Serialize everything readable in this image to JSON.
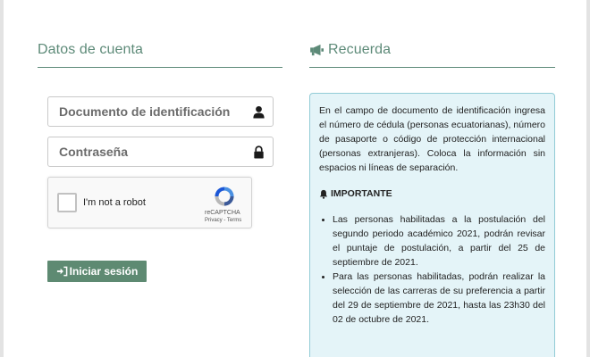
{
  "account_section": {
    "title": "Datos de cuenta",
    "id_field_placeholder": "Documento de identificación",
    "password_field_placeholder": "Contraseña",
    "captcha": {
      "label": "I'm not a robot",
      "brand": "reCAPTCHA",
      "links": "Privacy - Terms"
    },
    "login_button_label": "Iniciar sesión"
  },
  "reminder_section": {
    "title": "Recuerda",
    "intro": "En el campo de documento de identificación ingresa el número de cédula (personas ecuatorianas), número de pasaporte o código de protección internacional (personas extranjeras). Coloca la información sin espacios ni líneas de separación.",
    "important_label": "IMPORTANTE",
    "bullets": [
      "Las personas habilitadas a la postulación del segundo periodo académico 2021, podrán revisar el puntaje de postulación, a partir del 25 de septiembre de 2021.",
      "Para las personas habilitadas, podrán realizar la selección de las carreras de su preferencia a partir del 29 de septiembre de 2021, hasta las 23h30 del 02 de octubre de 2021."
    ]
  },
  "colors": {
    "accent": "#5d8a78",
    "button": "#5e8a72",
    "info_bg": "#e4f4f8",
    "info_border": "#92cbd6"
  },
  "icons": {
    "title_icon": "megaphone-icon",
    "id_field_icon": "user-icon",
    "password_field_icon": "lock-icon",
    "login_icon": "sign-in-icon",
    "important_icon": "bell-icon"
  }
}
